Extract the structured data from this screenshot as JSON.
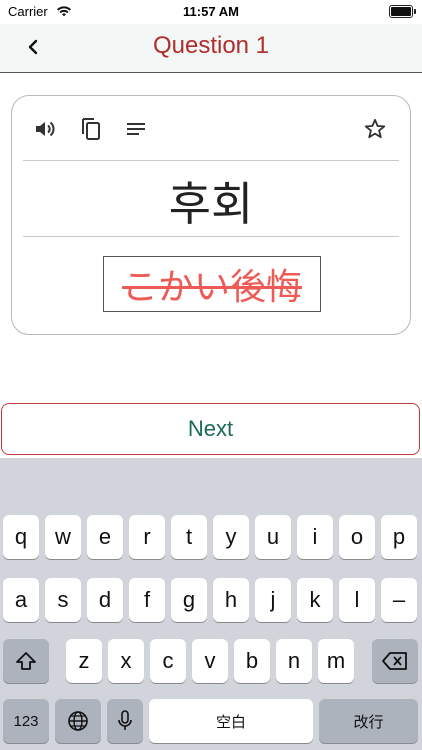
{
  "status_bar": {
    "carrier": "Carrier",
    "time": "11:57 AM"
  },
  "nav": {
    "title": "Question 1"
  },
  "card": {
    "word": "후회",
    "answer": "こかい後悔",
    "icons": [
      "speaker-icon",
      "copy-icon",
      "notes-icon",
      "star-icon"
    ]
  },
  "next_button": {
    "label": "Next"
  },
  "keyboard": {
    "row1": [
      "q",
      "w",
      "e",
      "r",
      "t",
      "y",
      "u",
      "i",
      "o",
      "p"
    ],
    "row2": [
      "a",
      "s",
      "d",
      "f",
      "g",
      "h",
      "j",
      "k",
      "l",
      "–"
    ],
    "row3": [
      "z",
      "x",
      "c",
      "v",
      "b",
      "n",
      "m"
    ],
    "numbers_key": "123",
    "space_key": "空白",
    "return_key": "改行"
  },
  "colors": {
    "title_red": "#b12c2c",
    "next_green": "#1b6b5a",
    "answer_red": "#ee5a55",
    "keyboard_bg": "#d1d4da"
  }
}
